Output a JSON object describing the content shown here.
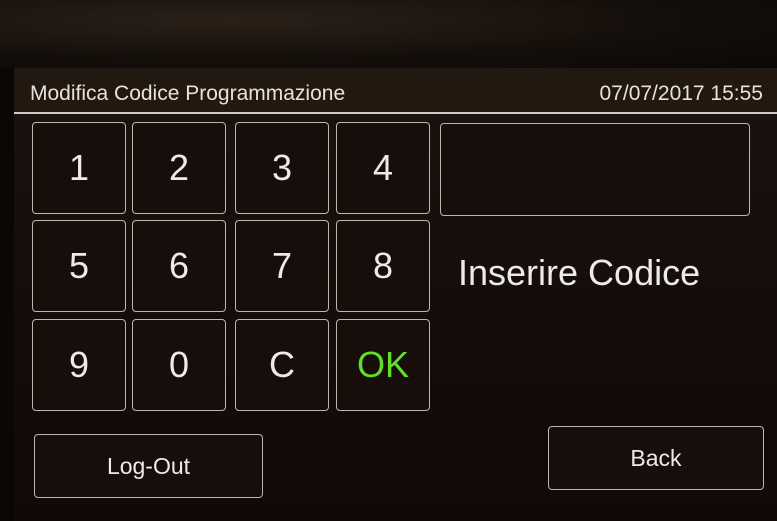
{
  "header": {
    "title": "Modifica Codice Programmazione",
    "datetime": "07/07/2017 15:55"
  },
  "keypad": {
    "k1": "1",
    "k2": "2",
    "k3": "3",
    "k4": "4",
    "k5": "5",
    "k6": "6",
    "k7": "7",
    "k8": "8",
    "k9": "9",
    "k0": "0",
    "clear": "C",
    "ok": "OK"
  },
  "code_display": {
    "value": ""
  },
  "prompt": "Inserire Codice",
  "buttons": {
    "logout": "Log-Out",
    "back": "Back"
  },
  "colors": {
    "ok_green": "#5ee026",
    "text": "#ecebe9",
    "border": "#bdb6ae"
  }
}
